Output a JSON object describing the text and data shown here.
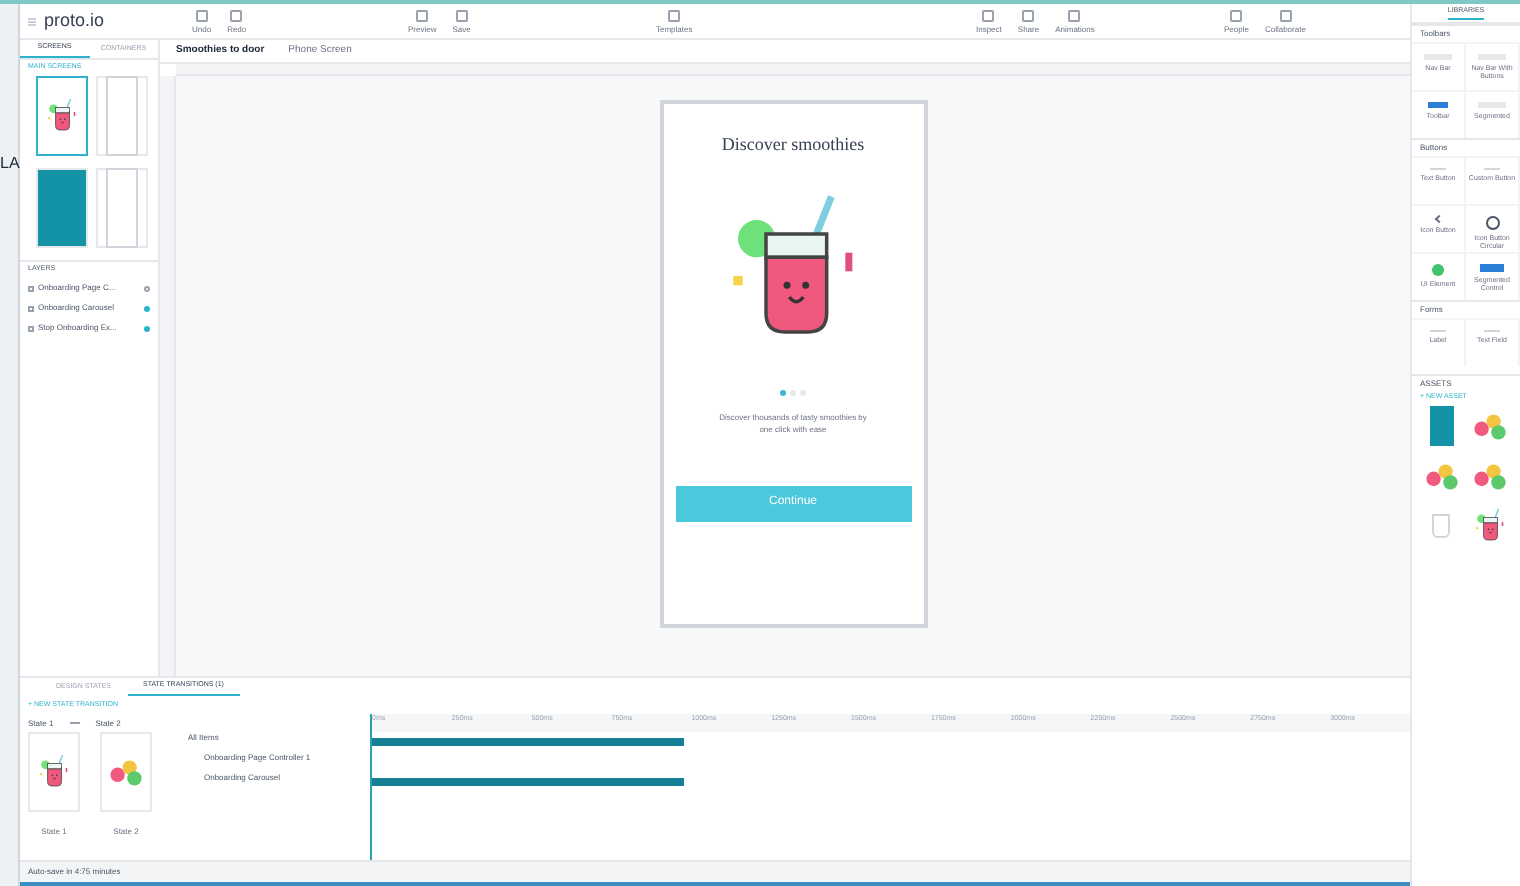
{
  "app": {
    "logo": "proto.io"
  },
  "toolbar": {
    "left": [
      "Undo",
      "Redo"
    ],
    "mid": [
      "Preview",
      "Save"
    ],
    "center": [
      "Templates"
    ],
    "right": [
      "Inspect",
      "Share",
      "Animations"
    ],
    "far": [
      "People",
      "Collaborate"
    ]
  },
  "side_tabs": [
    {
      "label": "SCREENS",
      "selected": true
    },
    {
      "label": "CONTAINERS",
      "selected": false
    }
  ],
  "background_window": {
    "text": "LA"
  },
  "screens": {
    "title": "MAIN SCREENS",
    "thumbs": [
      {
        "kind": "drink",
        "selected": true
      },
      {
        "kind": "plain",
        "selected": false
      },
      {
        "kind": "teal",
        "selected": false
      },
      {
        "kind": "plain",
        "selected": false
      }
    ]
  },
  "layers": {
    "title": "LAYERS",
    "items": [
      {
        "label": "Onboarding Page C...",
        "visible": false
      },
      {
        "label": "Onboarding Carousel",
        "visible": true
      },
      {
        "label": "Stop Onboarding Ex...",
        "visible": true
      }
    ]
  },
  "project": {
    "name": "Smoothies to door",
    "screen": "Phone Screen"
  },
  "phone": {
    "title": "Discover smoothies",
    "page_dots": [
      {
        "selected": true
      },
      {
        "selected": false
      },
      {
        "selected": false
      }
    ],
    "text": "Discover thousands of tasty smoothies by one click with ease",
    "button": "Continue"
  },
  "bottom_tabs": [
    {
      "label": "DESIGN STATES",
      "selected": false
    },
    {
      "label": "STATE TRANSITIONS (1)",
      "selected": true
    }
  ],
  "new_transition": "+ NEW STATE TRANSITION",
  "transition": {
    "from": "State 1",
    "to": "State 2"
  },
  "states": [
    {
      "label": "State 1",
      "kind": "drink"
    },
    {
      "label": "State 2",
      "kind": "fruit"
    }
  ],
  "timeline_rows": [
    {
      "label": "All Items",
      "kind": "group",
      "level": 0.3
    },
    {
      "label": "Onboarding Page Controller 1",
      "kind": "item"
    },
    {
      "label": "Onboarding Carousel",
      "kind": "item",
      "level": 0.3
    }
  ],
  "timeline_ticks": [
    "0ms",
    "250ms",
    "500ms",
    "750ms",
    "1000ms",
    "1250ms",
    "1500ms",
    "1750ms",
    "2000ms",
    "2250ms",
    "2500ms",
    "2750ms",
    "3000ms"
  ],
  "library": {
    "title": "LIBRARIES",
    "sections": [
      {
        "title": "Toolbars",
        "items": [
          {
            "label": "Nav Bar",
            "kind": "bar"
          },
          {
            "label": "Nav Bar With Buttons",
            "kind": "bar"
          },
          {
            "label": "Toolbar",
            "kind": "toggle"
          },
          {
            "label": "Segmented",
            "kind": "bar"
          }
        ]
      },
      {
        "title": "Buttons",
        "items": [
          {
            "label": "Text Button",
            "kind": "text"
          },
          {
            "label": "Custom Button",
            "kind": "text"
          },
          {
            "label": "Icon Button",
            "kind": "chevron"
          },
          {
            "label": "Icon Button Circular",
            "kind": "circle"
          },
          {
            "label": "UI Element",
            "kind": "dot"
          },
          {
            "label": "Segmented Control",
            "kind": "segment"
          }
        ]
      },
      {
        "title": "Forms",
        "items": [
          {
            "label": "Label",
            "kind": "text"
          },
          {
            "label": "Text Field",
            "kind": "text"
          }
        ]
      }
    ]
  },
  "assets": {
    "title": "ASSETS",
    "new": "+ NEW ASSET",
    "items": [
      {
        "kind": "teal"
      },
      {
        "kind": "fruit"
      },
      {
        "kind": "fruit"
      },
      {
        "kind": "fruit"
      },
      {
        "kind": "glass"
      },
      {
        "kind": "drink"
      }
    ]
  },
  "status": "Auto-save in 4:75 minutes"
}
